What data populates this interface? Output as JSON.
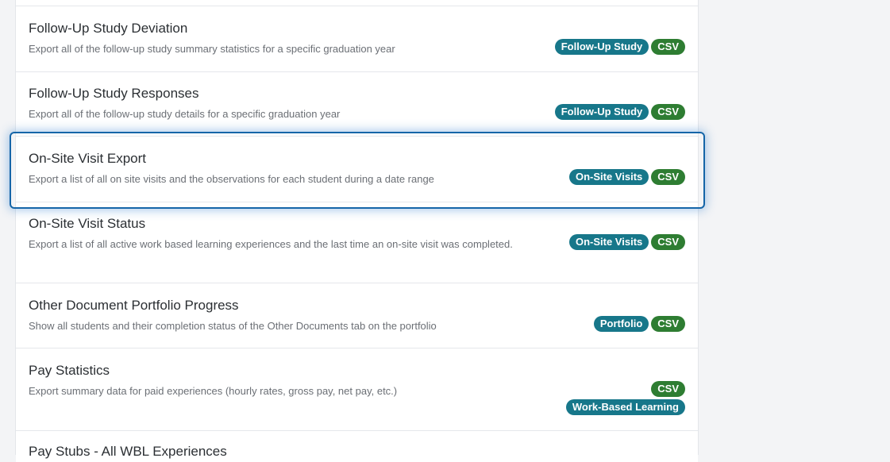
{
  "reports": [
    {
      "title": "Follow-Up Study Deviation",
      "description": "Export all of the follow-up study summary statistics for a specific graduation year",
      "badges": [
        {
          "label": "Follow-Up Study",
          "kind": "category"
        },
        {
          "label": "CSV",
          "kind": "format"
        }
      ]
    },
    {
      "title": "Follow-Up Study Responses",
      "description": "Export all of the follow-up study details for a specific graduation year",
      "badges": [
        {
          "label": "Follow-Up Study",
          "kind": "category"
        },
        {
          "label": "CSV",
          "kind": "format"
        }
      ]
    },
    {
      "title": "On-Site Visit Export",
      "description": "Export a list of all on site visits and the observations for each student during a date range",
      "badges": [
        {
          "label": "On-Site Visits",
          "kind": "category"
        },
        {
          "label": "CSV",
          "kind": "format"
        }
      ],
      "highlighted": true
    },
    {
      "title": "On-Site Visit Status",
      "description": "Export a list of all active work based learning experiences and the last time an on-site visit was completed.",
      "badges": [
        {
          "label": "On-Site Visits",
          "kind": "category"
        },
        {
          "label": "CSV",
          "kind": "format"
        }
      ]
    },
    {
      "title": "Other Document Portfolio Progress",
      "description": "Show all students and their completion status of the Other Documents tab on the portfolio",
      "badges": [
        {
          "label": "Portfolio",
          "kind": "category"
        },
        {
          "label": "CSV",
          "kind": "format"
        }
      ]
    },
    {
      "title": "Pay Statistics",
      "description": "Export summary data for paid experiences (hourly rates, gross pay, net pay, etc.)",
      "badges": [
        {
          "label": "CSV",
          "kind": "format"
        },
        {
          "label": "Work-Based Learning",
          "kind": "category"
        }
      ]
    },
    {
      "title": "Pay Stubs - All WBL Experiences",
      "description": "",
      "badges": []
    }
  ],
  "colors": {
    "category_badge": "#17778a",
    "format_badge": "#2e7d32",
    "highlight_border": "#1565a8"
  }
}
